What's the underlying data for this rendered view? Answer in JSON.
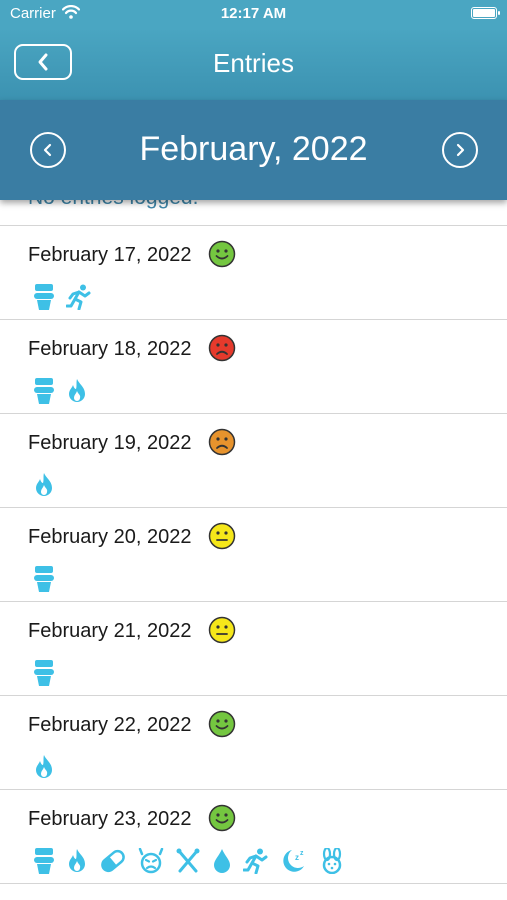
{
  "status_bar": {
    "carrier": "Carrier",
    "time": "12:17 AM"
  },
  "nav": {
    "title": "Entries"
  },
  "month_nav": {
    "title": "February, 2022"
  },
  "empty_message": "No entries logged.",
  "colors": {
    "happy": "#74c640",
    "sad": "#e53a2c",
    "worried": "#e7932d",
    "neutral": "#f5e71a",
    "icon_blue": "#3ec0e6"
  },
  "entries": [
    {
      "date": "February 17, 2022",
      "mood": "happy",
      "icons": [
        "toilet-icon",
        "running-icon"
      ]
    },
    {
      "date": "February 18, 2022",
      "mood": "sad",
      "icons": [
        "toilet-icon",
        "flame-icon"
      ]
    },
    {
      "date": "February 19, 2022",
      "mood": "worried",
      "icons": [
        "flame-icon"
      ]
    },
    {
      "date": "February 20, 2022",
      "mood": "neutral",
      "icons": [
        "toilet-icon"
      ]
    },
    {
      "date": "February 21, 2022",
      "mood": "neutral",
      "icons": [
        "toilet-icon"
      ]
    },
    {
      "date": "February 22, 2022",
      "mood": "happy",
      "icons": [
        "flame-icon"
      ]
    },
    {
      "date": "February 23, 2022",
      "mood": "happy",
      "icons": [
        "toilet-icon",
        "flame-icon",
        "pill-icon",
        "upset-face-icon",
        "utensils-icon",
        "water-drop-icon",
        "running-icon",
        "sleep-moon-icon",
        "rabbit-icon"
      ]
    }
  ]
}
